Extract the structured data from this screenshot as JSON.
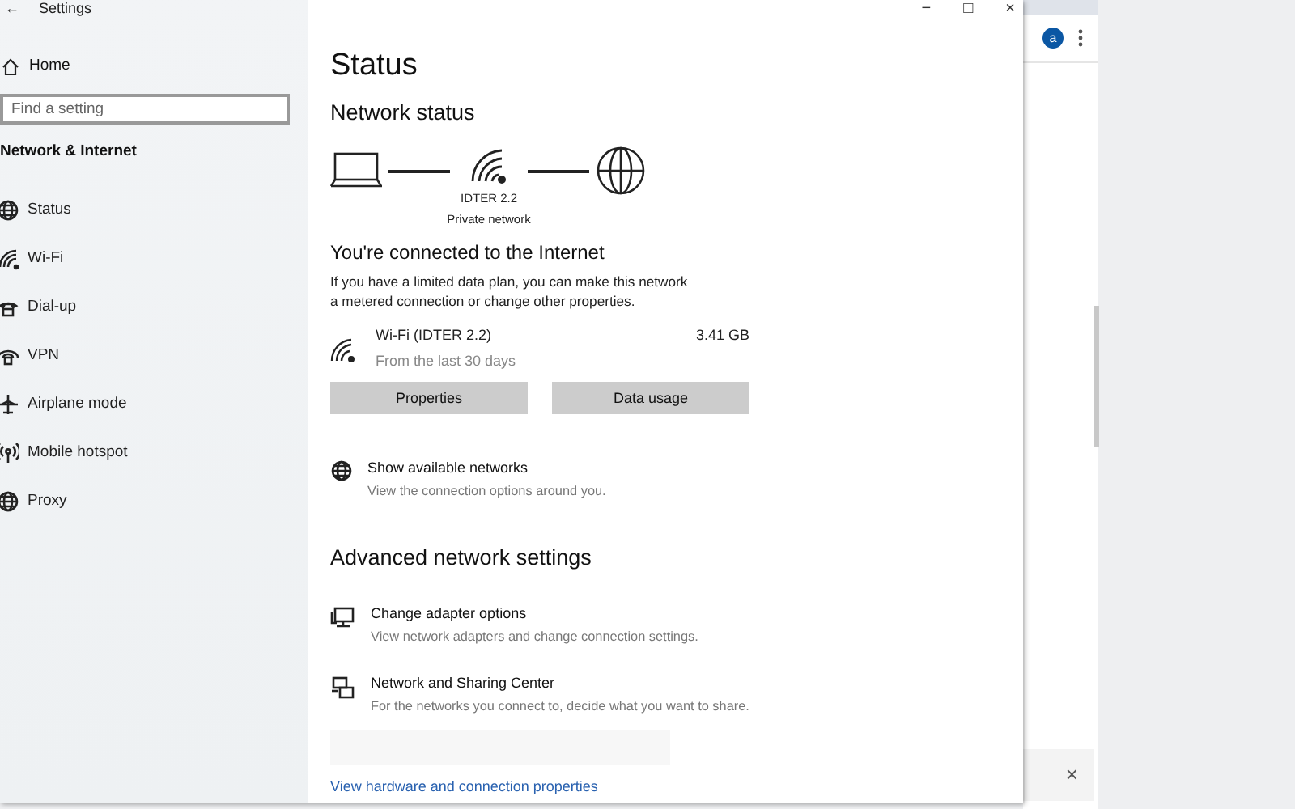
{
  "window": {
    "title": "Settings",
    "back": "←",
    "controls": [
      "−",
      "□",
      "×"
    ]
  },
  "sidebar": {
    "home": "Home",
    "search": {
      "placeholder": "Find a setting"
    },
    "section": "Network & Internet",
    "items": [
      {
        "label": "Status",
        "kind": "globe"
      },
      {
        "label": "Wi-Fi",
        "kind": "wifi"
      },
      {
        "label": "Dial-up",
        "kind": "phone"
      },
      {
        "label": "VPN",
        "kind": "vpn"
      },
      {
        "label": "Airplane mode",
        "kind": "plane"
      },
      {
        "label": "Mobile hotspot",
        "kind": "hotspot"
      },
      {
        "label": "Proxy",
        "kind": "globe"
      }
    ]
  },
  "content": {
    "title": "Status",
    "network_status": "Network status",
    "network_name": "IDTER 2.2",
    "network_type": "Private network",
    "connected_heading": "You're connected to the Internet",
    "connected_text": "If you have a limited data plan, you can make this network a metered connection or change other properties.",
    "connection": {
      "name": "Wi-Fi (IDTER 2.2)",
      "period": "From the last 30 days",
      "usage": "3.41 GB"
    },
    "buttons": [
      "Properties",
      "Data usage"
    ],
    "show_networks": {
      "title": "Show available networks",
      "desc": "View the connection options around you.",
      "kind": "globe"
    },
    "advanced_heading": "Advanced network settings",
    "advanced": [
      {
        "title": "Change adapter options",
        "desc": "View network adapters and change connection settings.",
        "kind": "monitor"
      },
      {
        "title": "Network and Sharing Center",
        "desc": "For the networks you connect to, decide what you want to share.",
        "kind": "sharing"
      }
    ],
    "link": "View hardware and connection properties"
  },
  "browser": {
    "avatar": "a",
    "bar_close": "×"
  }
}
